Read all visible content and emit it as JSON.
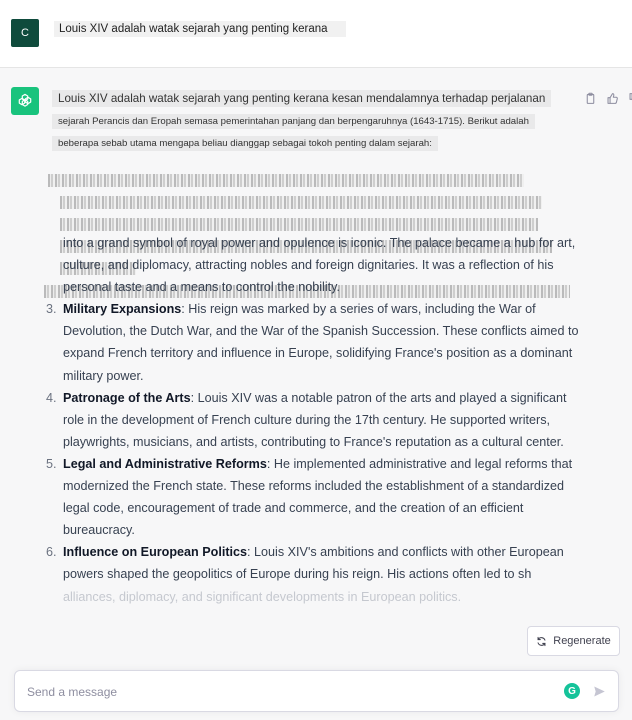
{
  "user": {
    "avatar_letter": "C",
    "message": "Louis XIV adalah watak sejarah yang penting kerana"
  },
  "assistant": {
    "translated_intro": [
      "Louis XIV adalah watak sejarah yang penting kerana kesan mendalamnya terhadap perjalanan",
      "sejarah Perancis dan Eropah semasa pemerintahan panjang dan berpengaruhnya (1643-1715). Berikut adalah",
      "beberapa sebab utama mengapa beliau dianggap sebagai tokoh penting dalam sejarah:"
    ],
    "continuation_lines": [
      "into a grand symbol of royal power and opulence is iconic. The palace became a hub for art,",
      "culture, and diplomacy, attracting nobles and foreign dignitaries. It was a reflection of his",
      "personal taste and a means to control the nobility."
    ],
    "items": [
      {
        "num": "3.",
        "title": "Military Expansions",
        "lines": [
          ": His reign was marked by a series of wars, including the War of",
          "Devolution, the Dutch War, and the War of the Spanish Succession. These conflicts aimed to",
          "expand French territory and influence in Europe, solidifying France's position as a dominant",
          "military power."
        ]
      },
      {
        "num": "4.",
        "title": "Patronage of the Arts",
        "lines": [
          ": Louis XIV was a notable patron of the arts and played a significant",
          "role in the development of French culture during the 17th century. He supported writers,",
          "playwrights, musicians, and artists, contributing to France's reputation as a cultural center."
        ]
      },
      {
        "num": "5.",
        "title": "Legal and Administrative Reforms",
        "lines": [
          ": He implemented administrative and legal reforms that",
          "modernized the French state. These reforms included the establishment of a standardized",
          "legal code, encouragement of trade and commerce, and the creation of an efficient",
          "bureaucracy."
        ]
      },
      {
        "num": "6.",
        "title": "Influence on European Politics",
        "lines": [
          ": Louis XIV's ambitions and conflicts with other European",
          "powers shaped the geopolitics of Europe during his reign. His actions often led to sh",
          "alliances, diplomacy, and significant developments in European politics."
        ]
      }
    ]
  },
  "regenerate_label": "Regenerate",
  "composer": {
    "placeholder": "Send a message"
  },
  "icons": {
    "assistant_avatar": "openai-logo-icon",
    "copy": "clipboard-icon",
    "thumbs_up": "thumbs-up-icon",
    "thumbs_down": "thumbs-down-icon",
    "regenerate": "refresh-icon",
    "grammarly": "grammarly-icon",
    "send": "send-icon"
  },
  "colors": {
    "user_avatar_bg": "#0f4b3c",
    "assistant_avatar_bg": "#19c37d",
    "assistant_bg": "#f7f7f8"
  }
}
